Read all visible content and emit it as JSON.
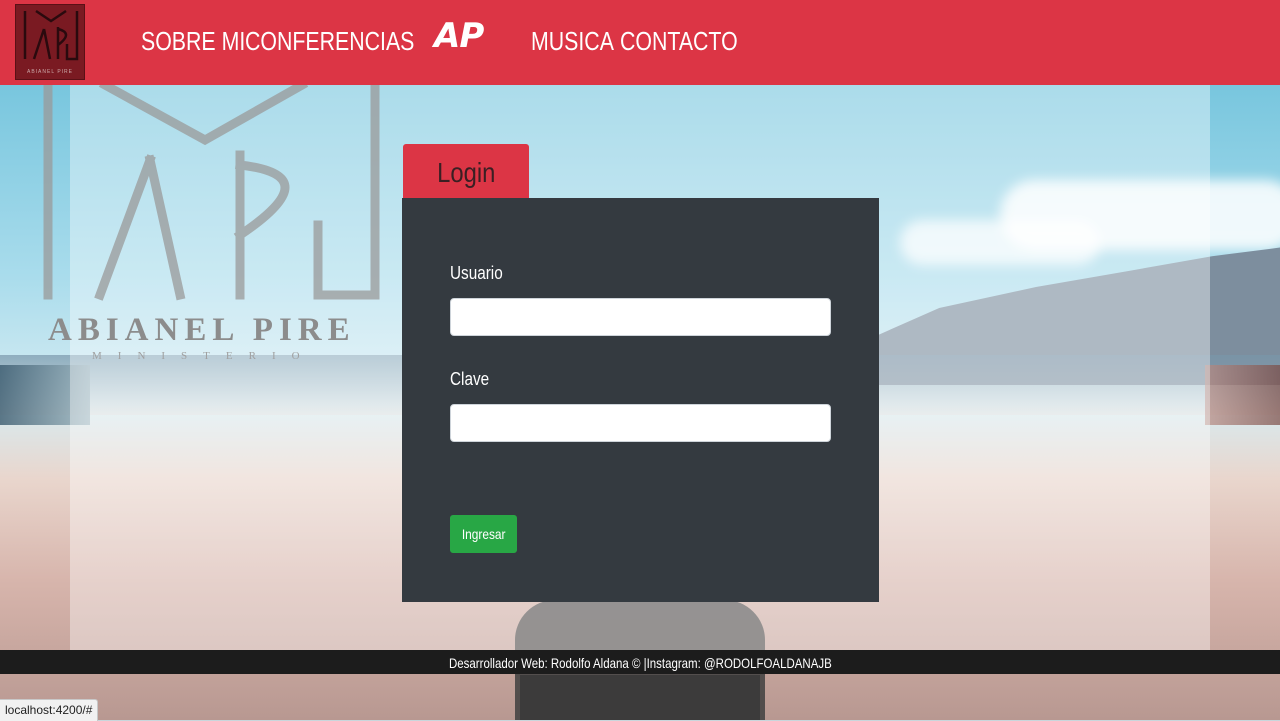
{
  "navbar": {
    "logo_text": "ABIANEL PIRE",
    "links_left": [
      "SOBRE MI",
      "CONFERENCIAS"
    ],
    "brand": "AP",
    "links_right": [
      "MUSICA",
      "CONTACTO"
    ]
  },
  "watermark": {
    "name": "ABIANEL PIRE",
    "subtitle": "MINISTERIO"
  },
  "login": {
    "tab_label": "Login",
    "username_label": "Usuario",
    "username_value": "",
    "password_label": "Clave",
    "password_value": "",
    "submit_label": "Ingresar"
  },
  "footer": {
    "text": "Desarrollador Web: Rodolfo Aldana © |Instagram: @RODOLFOALDANAJB"
  },
  "status_bar": {
    "url": "localhost:4200/#"
  },
  "colors": {
    "accent": "#dc3545",
    "card": "#343a40",
    "success": "#28a745",
    "footer": "#1c1c1c"
  }
}
